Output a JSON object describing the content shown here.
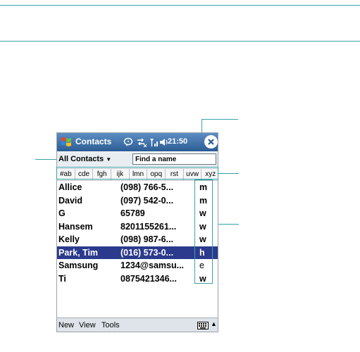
{
  "window": {
    "title": "Contacts",
    "clock": "21:50",
    "icons": [
      "windows-start-icon",
      "notification-icon",
      "connectivity-icon",
      "signal-icon",
      "volume-icon",
      "close-icon"
    ]
  },
  "filter": {
    "label": "All Contacts",
    "find_placeholder": "Find a name"
  },
  "alphabet_tabs": [
    "#ab",
    "cde",
    "fgh",
    "ijk",
    "lmn",
    "opq",
    "rst",
    "uvw",
    "xyz"
  ],
  "contacts": [
    {
      "name": "Allice",
      "detail": "(098) 766-5...",
      "type": "m"
    },
    {
      "name": "David",
      "detail": "(097) 542-0...",
      "type": "m"
    },
    {
      "name": "G",
      "detail": "65789",
      "type": "w"
    },
    {
      "name": "Hansem",
      "detail": "8201155261...",
      "type": "w"
    },
    {
      "name": "Kelly",
      "detail": "(098) 987-6...",
      "type": "w"
    },
    {
      "name": "Park, Tim",
      "detail": "(016) 573-0...",
      "type": "h",
      "selected": true
    },
    {
      "name": "Samsung",
      "detail": "1234@samsu...",
      "type": "e"
    },
    {
      "name": "Ti",
      "detail": "0875421346...",
      "type": "w"
    }
  ],
  "menu": {
    "new": "New",
    "view": "View",
    "tools": "Tools"
  },
  "colors": {
    "rule": "#38a3a8",
    "titlebar": "#2b5c93",
    "selection": "#2b3a8c"
  }
}
